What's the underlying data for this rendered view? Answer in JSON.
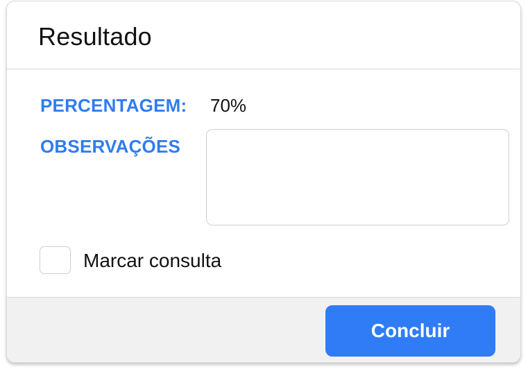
{
  "dialog": {
    "title": "Resultado"
  },
  "fields": {
    "percentage_label": "PERCENTAGEM:",
    "percentage_value": "70%",
    "observations_label": "OBSERVAÇÕES",
    "observations_value": "",
    "observations_placeholder": ""
  },
  "checkbox": {
    "label": "Marcar consulta",
    "checked": false
  },
  "footer": {
    "confirm_label": "Concluir"
  },
  "colors": {
    "accent": "#2f7cf0",
    "button": "#2f7cf6",
    "footer_bg": "#f1f1f1",
    "border": "#d9d9d9"
  }
}
